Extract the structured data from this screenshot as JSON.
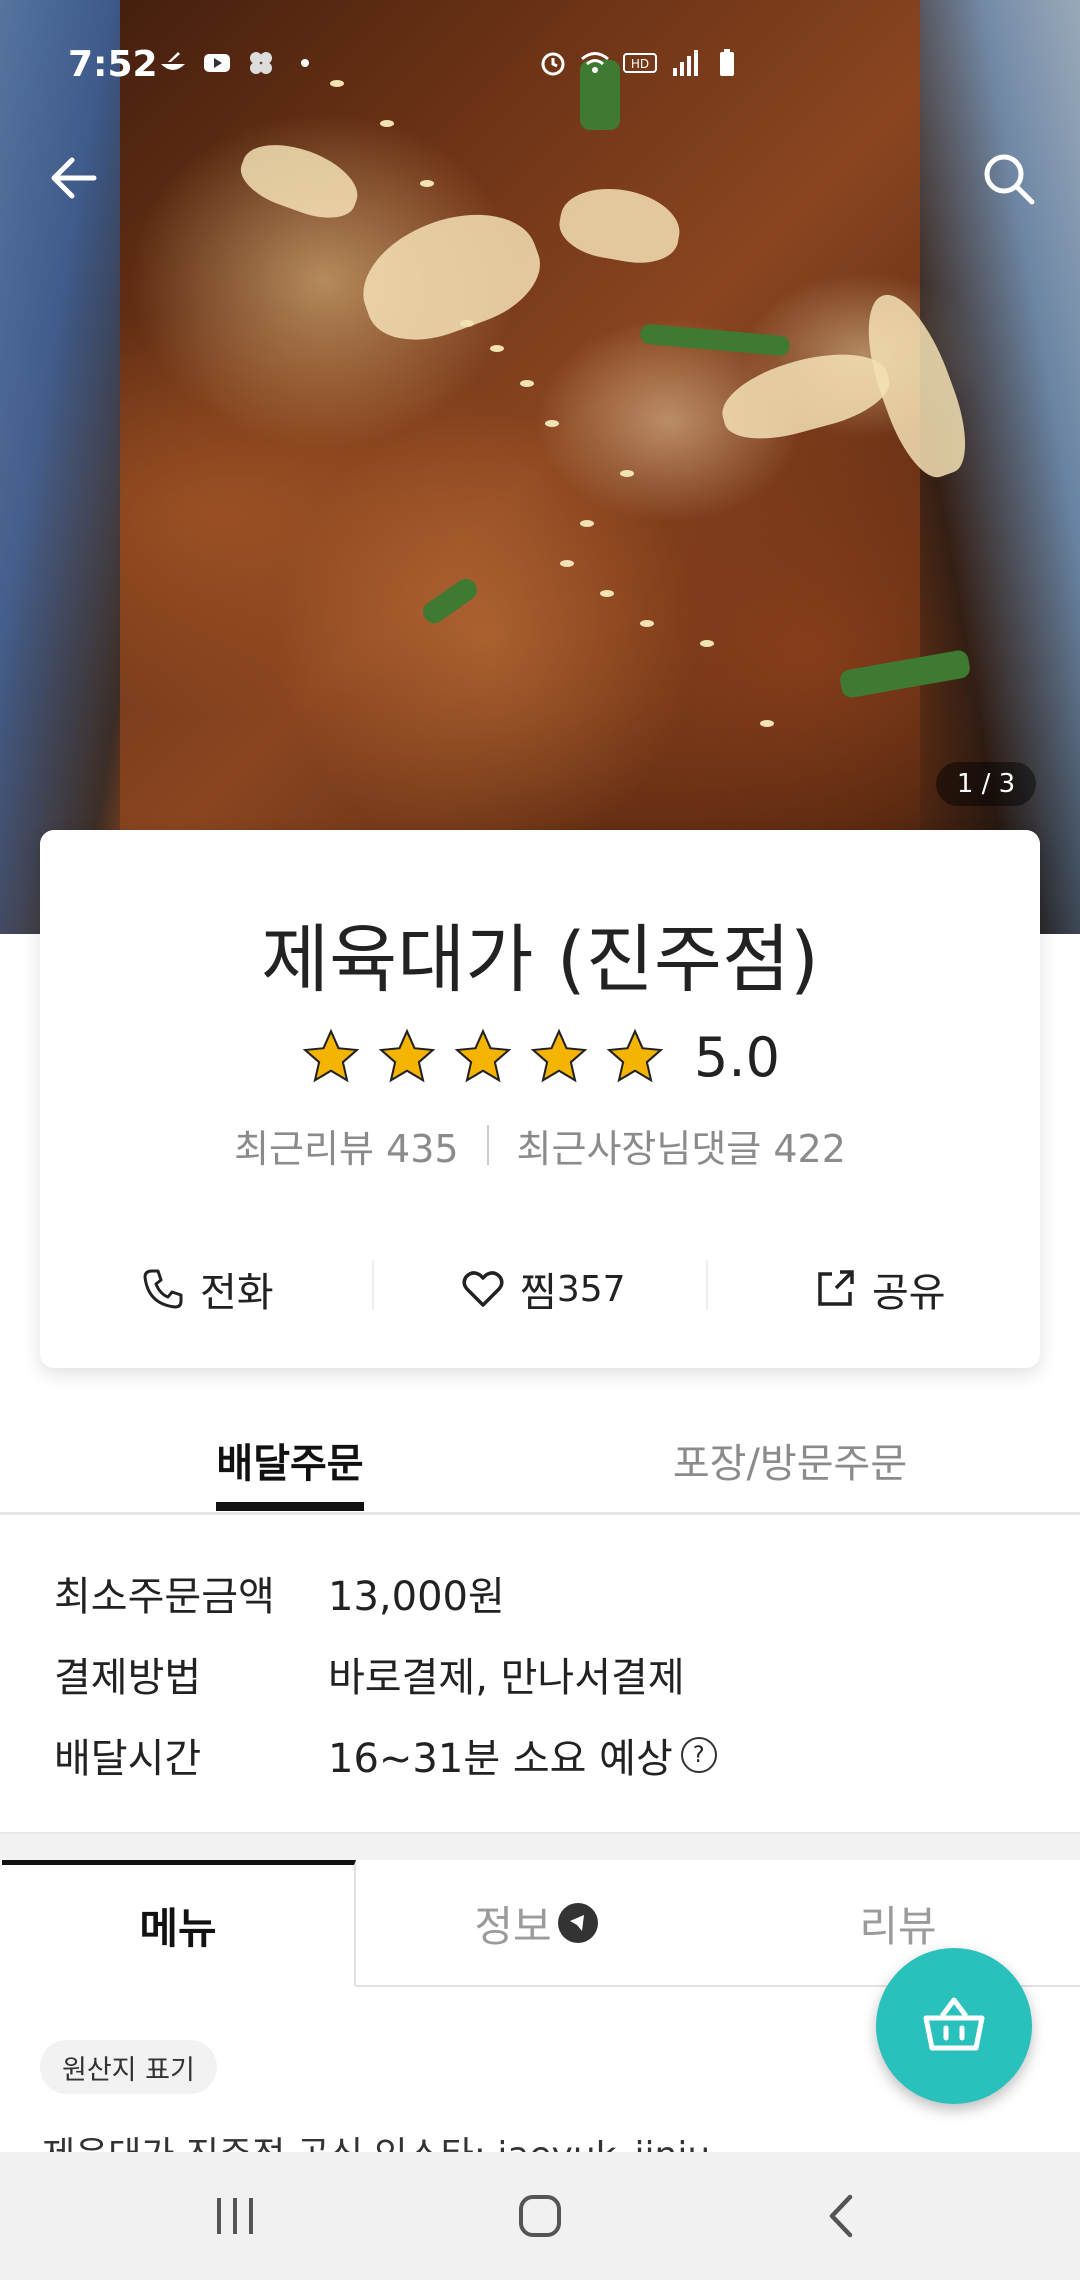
{
  "status_bar": {
    "time": "7:52"
  },
  "hero": {
    "photo_counter": "1 / 3"
  },
  "store": {
    "name": "제육대가 (진주점)",
    "rating": "5.0",
    "stars": 5,
    "recent_reviews": "최근리뷰 435",
    "owner_replies": "최근사장님댓글 422"
  },
  "actions": {
    "call": "전화",
    "favorite": "찜",
    "favorite_count": "357",
    "share": "공유"
  },
  "order_tabs": {
    "delivery": "배달주문",
    "pickup": "포장/방문주문"
  },
  "delivery_info": [
    {
      "label": "최소주문금액",
      "value": "13,000원"
    },
    {
      "label": "결제방법",
      "value": "바로결제, 만나서결제"
    },
    {
      "label": "배달시간",
      "value": "16~31분 소요 예상"
    }
  ],
  "menu_tabs": {
    "menu": "메뉴",
    "info": "정보",
    "review": "리뷰"
  },
  "origin_chip": "원산지 표기",
  "notice": "제육대가 진주점 공식 인스타: jaeyuk_jinju",
  "colors": {
    "accent": "#2ac1bc",
    "star": "#f5b400"
  }
}
